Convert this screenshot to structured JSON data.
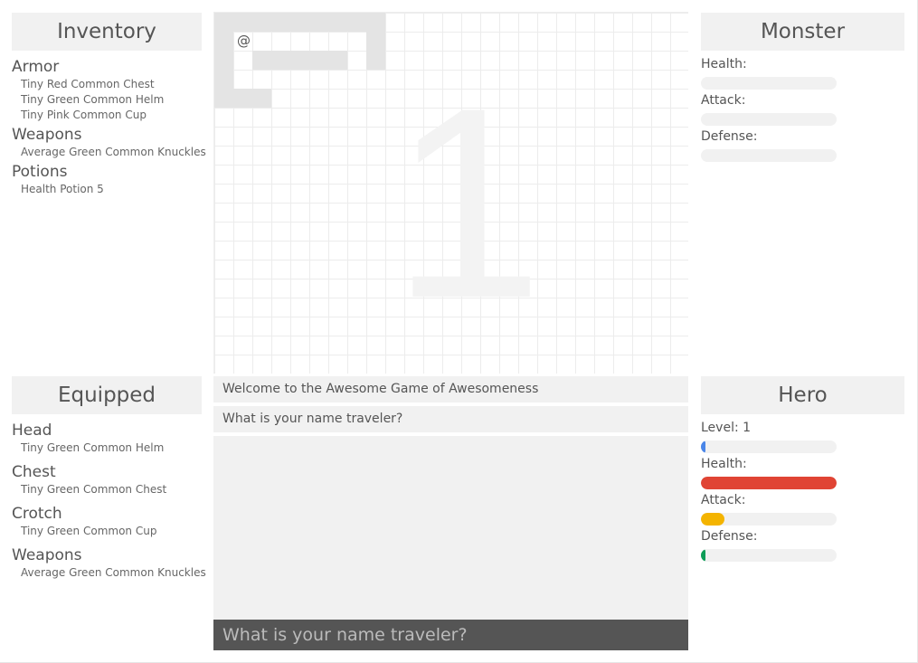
{
  "inventory": {
    "title": "Inventory",
    "armor_title": "Armor",
    "armor": [
      "Tiny Red Common Chest",
      "Tiny Green Common Helm",
      "Tiny Pink Common Cup"
    ],
    "weapons_title": "Weapons",
    "weapons": [
      "Average Green Common Knuckles"
    ],
    "potions_title": "Potions",
    "potions": [
      "Health Potion 5"
    ]
  },
  "equipped": {
    "title": "Equipped",
    "head_title": "Head",
    "head": "Tiny Green Common Helm",
    "chest_title": "Chest",
    "chest": "Tiny Green Common Chest",
    "crotch_title": "Crotch",
    "crotch": "Tiny Green Common Cup",
    "weapons_title": "Weapons",
    "weapons": "Average Green Common Knuckles"
  },
  "map": {
    "level_watermark": "1",
    "player_symbol": "@"
  },
  "messages": {
    "welcome": "Welcome to the Awesome Game of Awesomeness",
    "prompt": "What is your name traveler?",
    "input_placeholder": "What is your name traveler?"
  },
  "monster": {
    "title": "Monster",
    "health_label": "Health:",
    "attack_label": "Attack:",
    "defense_label": "Defense:"
  },
  "hero": {
    "title": "Hero",
    "level_label": "Level: 1",
    "health_label": "Health:",
    "attack_label": "Attack:",
    "defense_label": "Defense:",
    "level_progress": 0.03,
    "health_progress": 1.0,
    "attack_progress": 0.17,
    "defense_progress": 0.03
  },
  "colors": {
    "level_bar": "#4a86e8",
    "health_bar": "#e04434",
    "attack_bar": "#f4b400",
    "defense_bar": "#0f9d58"
  }
}
